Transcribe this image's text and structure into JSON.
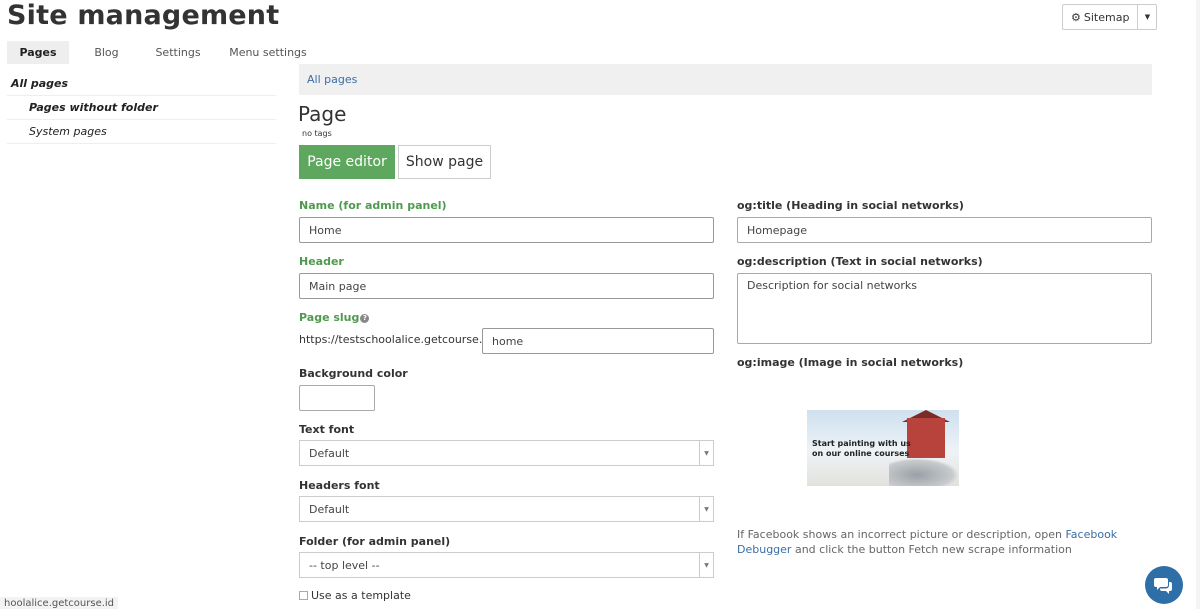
{
  "header": {
    "title": "Site management",
    "sitemap_label": "Sitemap"
  },
  "top_tabs": [
    {
      "label": "Pages",
      "active": true
    },
    {
      "label": "Blog",
      "active": false
    },
    {
      "label": "Settings",
      "active": false
    },
    {
      "label": "Menu settings",
      "active": false
    }
  ],
  "sidebar": {
    "items": [
      {
        "label": "All pages"
      },
      {
        "label": "Pages without folder"
      },
      {
        "label": "System pages"
      }
    ]
  },
  "breadcrumb": {
    "all_pages": "All pages"
  },
  "editor": {
    "title": "Page",
    "tags": "no tags",
    "page_editor_btn": "Page editor",
    "show_page_btn": "Show page"
  },
  "form": {
    "name_label": "Name (for admin panel)",
    "name_value": "Home",
    "header_label": "Header",
    "header_value": "Main page",
    "slug_label": "Page slug",
    "slug_prefix": "https://testschoolalice.getcourse.id/",
    "slug_value": "home",
    "bg_color_label": "Background color",
    "bg_color_value": "",
    "text_font_label": "Text font",
    "text_font_value": "Default",
    "headers_font_label": "Headers font",
    "headers_font_value": "Default",
    "folder_label": "Folder (for admin panel)",
    "folder_value": "-- top level --",
    "template_label": "Use as a template"
  },
  "og": {
    "title_label": "og:title (Heading in social networks)",
    "title_value": "Homepage",
    "description_label": "og:description (Text in social networks)",
    "description_value": "Description for social networks",
    "image_label": "og:image (Image in social networks)",
    "image_caption": "Start painting with us on our online courses",
    "fb_note_prefix": "If Facebook shows an incorrect picture or description, open ",
    "fb_link": "Facebook Debugger",
    "fb_note_suffix": " and click the button Fetch new scrape information"
  },
  "status": {
    "url_hint": "hoolalice.getcourse.id"
  },
  "colors": {
    "accent_green": "#5ea75e",
    "link_blue": "#3a6ea5",
    "chat_blue": "#2f6fa8"
  }
}
